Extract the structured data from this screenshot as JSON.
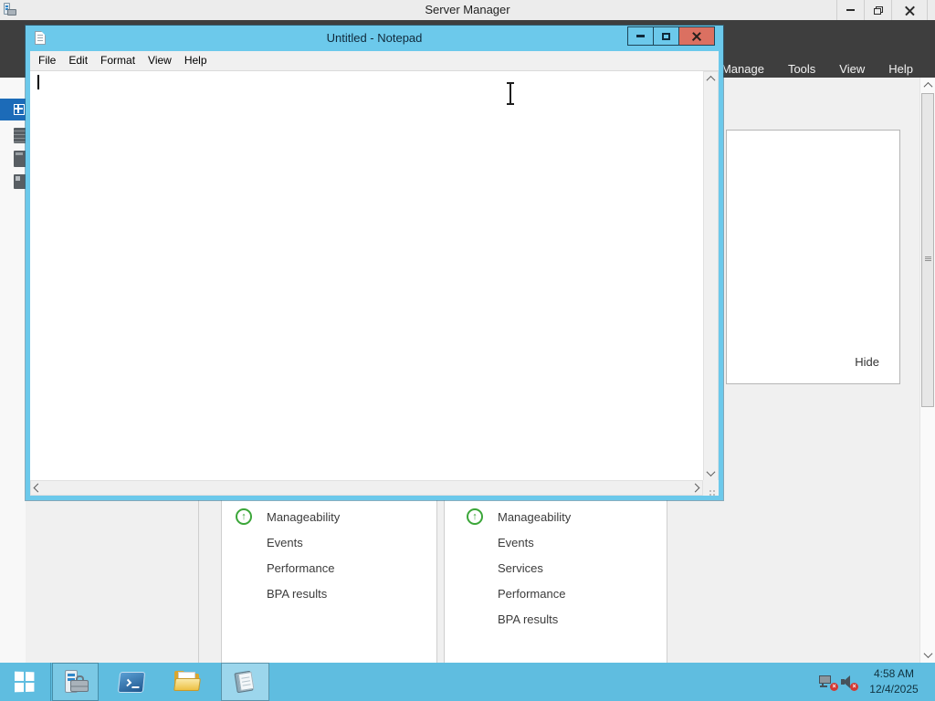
{
  "server_manager": {
    "title": "Server Manager",
    "header_menu": [
      "Manage",
      "Tools",
      "View",
      "Help"
    ],
    "panel": {
      "hide_label": "Hide"
    },
    "dashboard_tiles": [
      {
        "title": "Manageability",
        "items": [
          "Events",
          "Performance",
          "BPA results"
        ]
      },
      {
        "title": "Manageability",
        "items": [
          "Events",
          "Services",
          "Performance",
          "BPA results"
        ]
      }
    ]
  },
  "notepad": {
    "title": "Untitled - Notepad",
    "menu": [
      "File",
      "Edit",
      "Format",
      "View",
      "Help"
    ],
    "text_content": ""
  },
  "taskbar": {
    "time": "4:58 AM",
    "date": "12/4/2025"
  },
  "colors": {
    "taskbar_blue": "#5fbde0",
    "notepad_chrome": "#6cc9eb",
    "close_button_red": "#db7061",
    "header_band_gray": "#3e3e3e",
    "selection_blue": "#1c6bb8",
    "status_green": "#3ba639"
  },
  "status_icon_glyph": "↑"
}
